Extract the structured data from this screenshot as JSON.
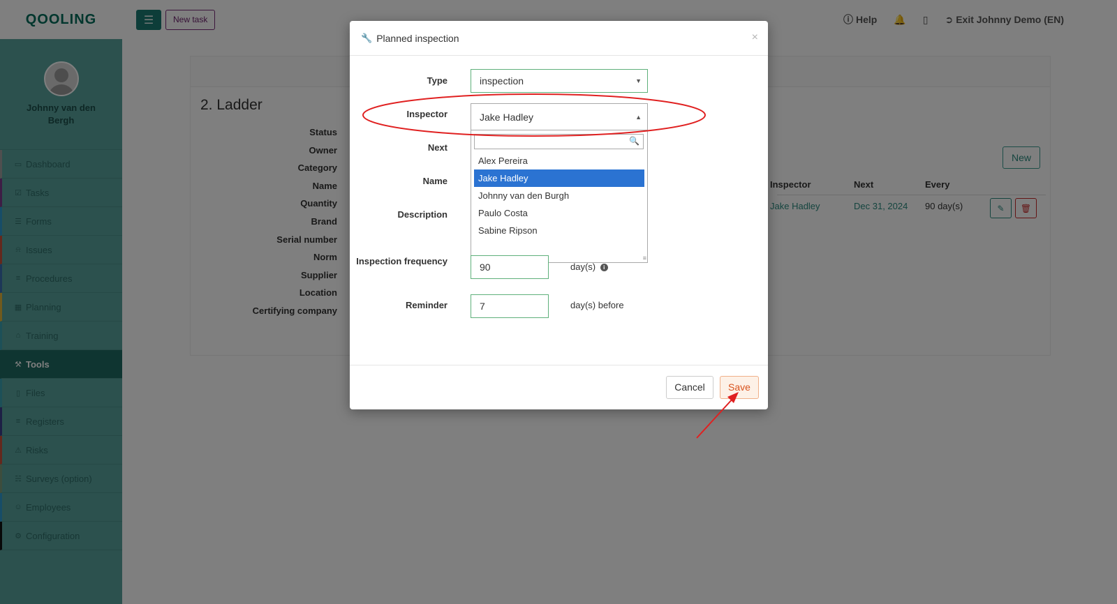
{
  "brand": {
    "logo": "QOOLING"
  },
  "topbar": {
    "new_task": "New task",
    "help": "Help",
    "exit": "Exit Johnny Demo (EN)"
  },
  "sidebar": {
    "user_name": "Johnny van den Bergh",
    "items": [
      {
        "label": "Dashboard",
        "icon": "monitor-icon",
        "color": "#9e9e9e"
      },
      {
        "label": "Tasks",
        "icon": "check-square-icon",
        "color": "#7b3a8a"
      },
      {
        "label": "Forms",
        "icon": "document-icon",
        "color": "#2e9ad0"
      },
      {
        "label": "Issues",
        "icon": "bell-icon",
        "color": "#c9503a"
      },
      {
        "label": "Procedures",
        "icon": "list-icon",
        "color": "#3a6fb0"
      },
      {
        "label": "Planning",
        "icon": "calendar-icon",
        "color": "#e2b53a"
      },
      {
        "label": "Training",
        "icon": "graduation-cap-icon",
        "color": "#3aa0b0"
      },
      {
        "label": "Tools",
        "icon": "wrench-icon",
        "color": "#1e6a62",
        "active": true
      },
      {
        "label": "Files",
        "icon": "file-icon",
        "color": "#3aa0b0"
      },
      {
        "label": "Registers",
        "icon": "bars-icon",
        "color": "#3a3f8a"
      },
      {
        "label": "Risks",
        "icon": "warning-icon",
        "color": "#c9503a"
      },
      {
        "label": "Surveys (option)",
        "icon": "chat-icon",
        "color": "#7a9a7a"
      },
      {
        "label": "Employees",
        "icon": "users-icon",
        "color": "#2e9ad0"
      },
      {
        "label": "Configuration",
        "icon": "gear-icon",
        "color": "#111111"
      }
    ]
  },
  "page": {
    "title": "2. Ladder",
    "properties": [
      "Status",
      "Owner",
      "Category",
      "Name",
      "Quantity",
      "Brand",
      "Serial number",
      "Norm",
      "Supplier",
      "Location",
      "Certifying company"
    ],
    "new_button": "New",
    "table": {
      "headers": {
        "inspector": "Inspector",
        "next": "Next",
        "every": "Every"
      },
      "row": {
        "inspector": "Jake Hadley",
        "next": "Dec 31, 2024",
        "every": "90 day(s)"
      }
    }
  },
  "modal": {
    "title": "Planned inspection",
    "close": "×",
    "type": {
      "label": "Type",
      "value": "inspection"
    },
    "inspector": {
      "label": "Inspector",
      "value": "Jake Hadley",
      "options": [
        "Alex Pereira",
        "Jake Hadley",
        "Johnny van den Burgh",
        "Paulo Costa",
        "Sabine Ripson"
      ],
      "selected_index": 1
    },
    "next": {
      "label": "Next"
    },
    "name": {
      "label": "Name"
    },
    "description": {
      "label": "Description"
    },
    "frequency": {
      "label": "Inspection frequency",
      "value": "90",
      "unit": "day(s)"
    },
    "reminder": {
      "label": "Reminder",
      "value": "7",
      "unit": "day(s) before"
    },
    "cancel": "Cancel",
    "save": "Save"
  },
  "annotation_color": "#e02020"
}
